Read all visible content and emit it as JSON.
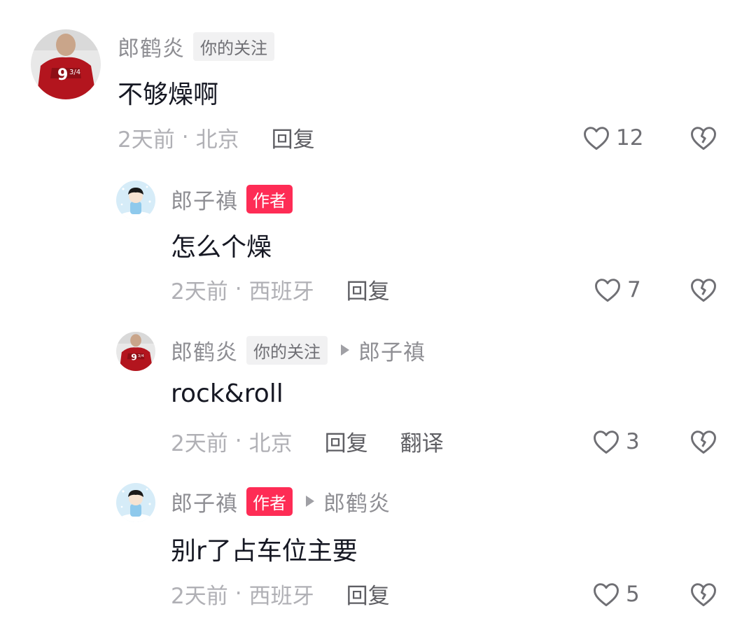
{
  "comments": [
    {
      "user": "郎鹤炎",
      "tag": "你的关注",
      "text": "不够燥啊",
      "time": "2天前",
      "location": "北京",
      "actions": [
        "回复"
      ],
      "likes": "12"
    }
  ],
  "replies": [
    {
      "user": "郎子禛",
      "tag": "作者",
      "text": "怎么个燥",
      "time": "2天前",
      "location": "西班牙",
      "actions": [
        "回复"
      ],
      "likes": "7"
    },
    {
      "user": "郎鹤炎",
      "tag": "你的关注",
      "reply_to": "郎子禛",
      "text": "rock&roll",
      "time": "2天前",
      "location": "北京",
      "actions": [
        "回复",
        "翻译"
      ],
      "likes": "3"
    },
    {
      "user": "郎子禛",
      "tag": "作者",
      "reply_to": "郎鹤炎",
      "text": "别r了占车位主要",
      "time": "2天前",
      "location": "西班牙",
      "actions": [
        "回复"
      ],
      "likes": "5"
    }
  ],
  "separator": "·",
  "icons": {
    "like": "heart-outline-icon",
    "dislike": "broken-heart-icon",
    "reply_arrow": "play-triangle-icon"
  },
  "colors": {
    "author_tag": "#fe2c55",
    "follow_tag_bg": "#f1f1f2",
    "username": "#8e8e93",
    "text": "#161823"
  }
}
